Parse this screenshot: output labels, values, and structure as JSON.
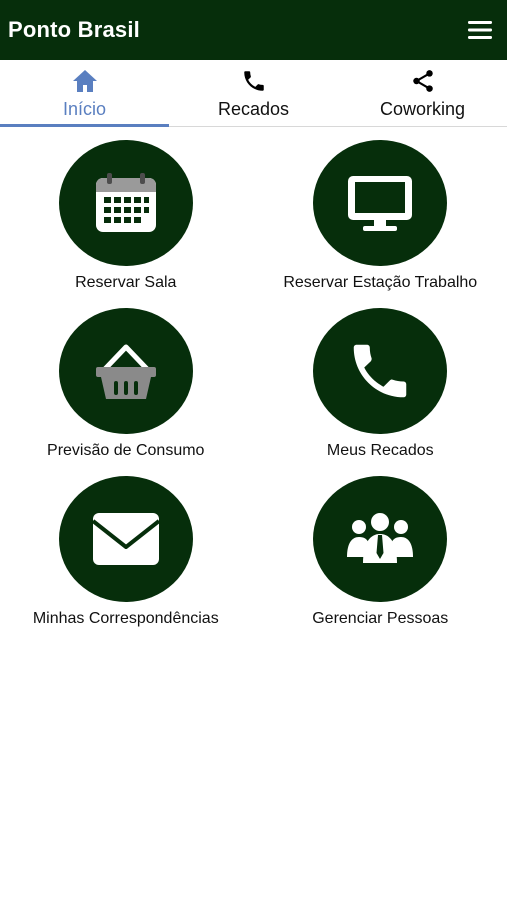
{
  "header": {
    "title": "Ponto Brasil",
    "menu_icon": "hamburger-menu-icon",
    "background": "#062e0b"
  },
  "tabs": [
    {
      "label": "Início",
      "icon": "home-icon",
      "active": true
    },
    {
      "label": "Recados",
      "icon": "phone-icon",
      "active": false
    },
    {
      "label": "Coworking",
      "icon": "share-icon",
      "active": false
    }
  ],
  "accent": "#5a7fc0",
  "tiles": [
    {
      "label": "Reservar Sala",
      "icon": "calendar-icon"
    },
    {
      "label": "Reservar Estação Trabalho",
      "icon": "monitor-icon"
    },
    {
      "label": "Previsão de Consumo",
      "icon": "basket-icon"
    },
    {
      "label": "Meus Recados",
      "icon": "phone-icon"
    },
    {
      "label": "Minhas Correspondências",
      "icon": "envelope-icon"
    },
    {
      "label": "Gerenciar Pessoas",
      "icon": "people-icon"
    }
  ]
}
